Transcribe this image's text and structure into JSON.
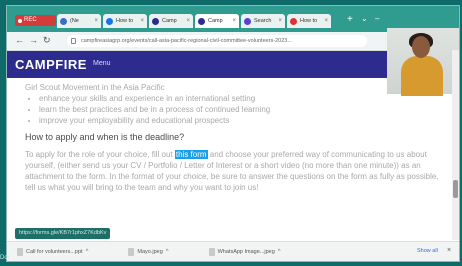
{
  "recording": {
    "label": "REC"
  },
  "tabs": [
    {
      "label": "(Ne"
    },
    {
      "label": "How to"
    },
    {
      "label": "Camp"
    },
    {
      "label": "Camp"
    },
    {
      "label": "Search"
    },
    {
      "label": "How to"
    }
  ],
  "address": {
    "url": "campfireasiagrp.org/events/call-asia-pacific-regional-civil-committee-volunteers-2023..."
  },
  "site": {
    "logo": "CAMPFIRE",
    "menu_label": "Menu"
  },
  "content": {
    "intro_line": "Girl Scout Movement in the Asia Pacific",
    "bullets": [
      "enhance your skills and experience in an international setting",
      "learn the best practices and be in a process of continued learning",
      "improve your employability and educational prospects"
    ],
    "heading": "How to apply and when is the deadline?",
    "para_before": "To apply for the role of your choice, fill out",
    "para_link": "this form",
    "para_after": "and choose your preferred way of communicating to us about yourself, (either send us your CV / Portfolio / Letter of Interest or a short video (no more than one minute)) as an attachment to the form. In the format of your choice, be sure to answer the questions on the form as fully as possible, tell us what you will bring to the team and why you want to join us!"
  },
  "status_url": "https://forms.gle/KB7r1phxZ7KdbKv",
  "downloads": [
    {
      "label": "Call for volunteers...ppt"
    },
    {
      "label": "Mayo.jpeg"
    },
    {
      "label": "WhatsApp Image...jpeg"
    }
  ],
  "downloads_show_all": "Show all",
  "left_caption": "Doi"
}
